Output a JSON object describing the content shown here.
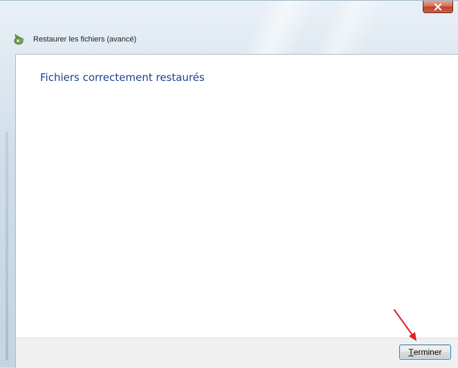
{
  "window": {
    "title": "Restaurer les fichiers (avancé)",
    "close_glyph": "x",
    "close_icon": "close-icon",
    "app_icon": "restore-files-icon"
  },
  "main": {
    "heading": "Fichiers correctement restaurés"
  },
  "footer": {
    "finish_button": {
      "mnemonic": "T",
      "rest": "erminer"
    }
  },
  "annotation": {
    "arrow_icon": "red-arrow-icon",
    "color": "#e02020"
  },
  "colors": {
    "heading": "#1e3f8f",
    "close_button": "#c0432c",
    "button_border": "#3c7fb1"
  }
}
